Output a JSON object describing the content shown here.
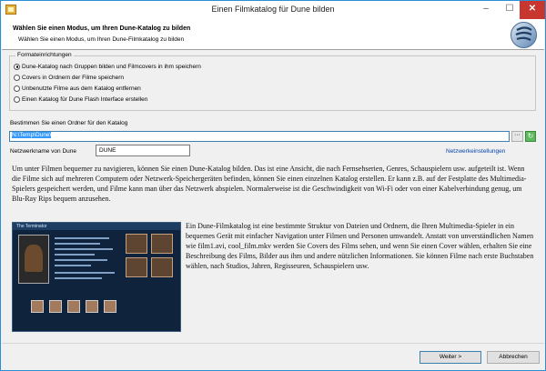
{
  "window": {
    "title": "Einen Filmkatalog für Dune bilden",
    "minimize": "–",
    "maximize": "☐",
    "close": "✕"
  },
  "header": {
    "title": "Wählen Sie einen Modus, um Ihren Dune-Katalog zu bilden",
    "subtitle": "Wählen Sie einen Modus, um Ihren Dune-Filmkatalog zu bilden"
  },
  "format": {
    "legend": "Formateinrichtungen",
    "options": [
      {
        "label": "Dune-Katalog nach Gruppen bilden und Filmcovers in ihm speichern",
        "checked": true
      },
      {
        "label": "Covers in Ordnern der Filme speichern",
        "checked": false
      },
      {
        "label": "Unbenutzte Filme aus dem Katalog entfernen",
        "checked": false
      },
      {
        "label": "Einen Katalog für Dune Flash Interface erstellen",
        "checked": false
      }
    ]
  },
  "folder": {
    "label": "Bestimmen Sie einen Ordner für den Katalog",
    "value": "N:\\Temp\\Dune\\",
    "browse": "···",
    "refresh": "↻"
  },
  "network": {
    "label": "Netzwerkname von Dune",
    "value": "DUNE",
    "settings_link": "Netzwerkeinstellungen"
  },
  "content": {
    "paragraph1": "Um unter Filmen bequemer zu navigieren, können Sie einen Dune-Katalog bilden. Das ist eine Ansicht, die nach Fernsehserien, Genres, Schauspielern usw. aufgeteilt ist. Wenn die Filme sich auf mehreren Computern oder Netzwerk-Speichergeräten befinden, können Sie einen einzelnen Katalog erstellen. Er kann z.B. auf der Festplatte des Multimedia-Spielers gespeichert werden, und Filme kann man über das Netzwerk abspielen. Normalerweise ist die Geschwindigkeit von Wi-Fi oder von einer Kabelverbindung genug, um Blu-Ray Rips bequem anzusehen.",
    "paragraph2": "Ein Dune-Filmkatalog ist eine bestimmte Struktur von Dateien und Ordnern, die Ihren Multimedia-Spieler in ein bequemes Gerät mit einfacher Navigation unter Filmen und Personen umwandelt. Anstatt von unverständlichen Namen wie film1.avi, cool_film.mkv werden Sie Covers des Films sehen, und wenn Sie einen Cover wählen, erhalten Sie eine Beschreibung des Films, Bilder aus ihm und andere nützlichen Informationen. Sie können Filme nach erste Buchstaben wählen, nach Studios, Jahren, Regisseuren, Schauspielern usw.",
    "screenshot_title": "The Terminator"
  },
  "footer": {
    "next": "Weiter >",
    "cancel": "Abbrechen"
  }
}
